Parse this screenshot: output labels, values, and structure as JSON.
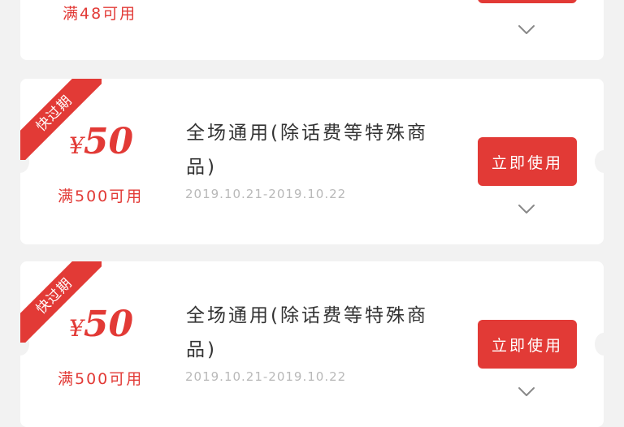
{
  "coupons": [
    {
      "condition": "满48可用",
      "button_label": "",
      "partial": true
    },
    {
      "ribbon": "快过期",
      "currency": "¥",
      "amount": "50",
      "condition": "满500可用",
      "title": "全场通用(除话费等特殊商品)",
      "date_range": "2019.10.21-2019.10.22",
      "button_label": "立即使用"
    },
    {
      "ribbon": "快过期",
      "currency": "¥",
      "amount": "50",
      "condition": "满500可用",
      "title": "全场通用(除话费等特殊商品)",
      "date_range": "2019.10.21-2019.10.22",
      "button_label": "立即使用"
    }
  ],
  "colors": {
    "accent": "#e23a36",
    "background": "#f2f2f2",
    "card": "#ffffff",
    "date_text": "#b9b9b9"
  },
  "icons": {
    "expand": "chevron-down-icon"
  }
}
